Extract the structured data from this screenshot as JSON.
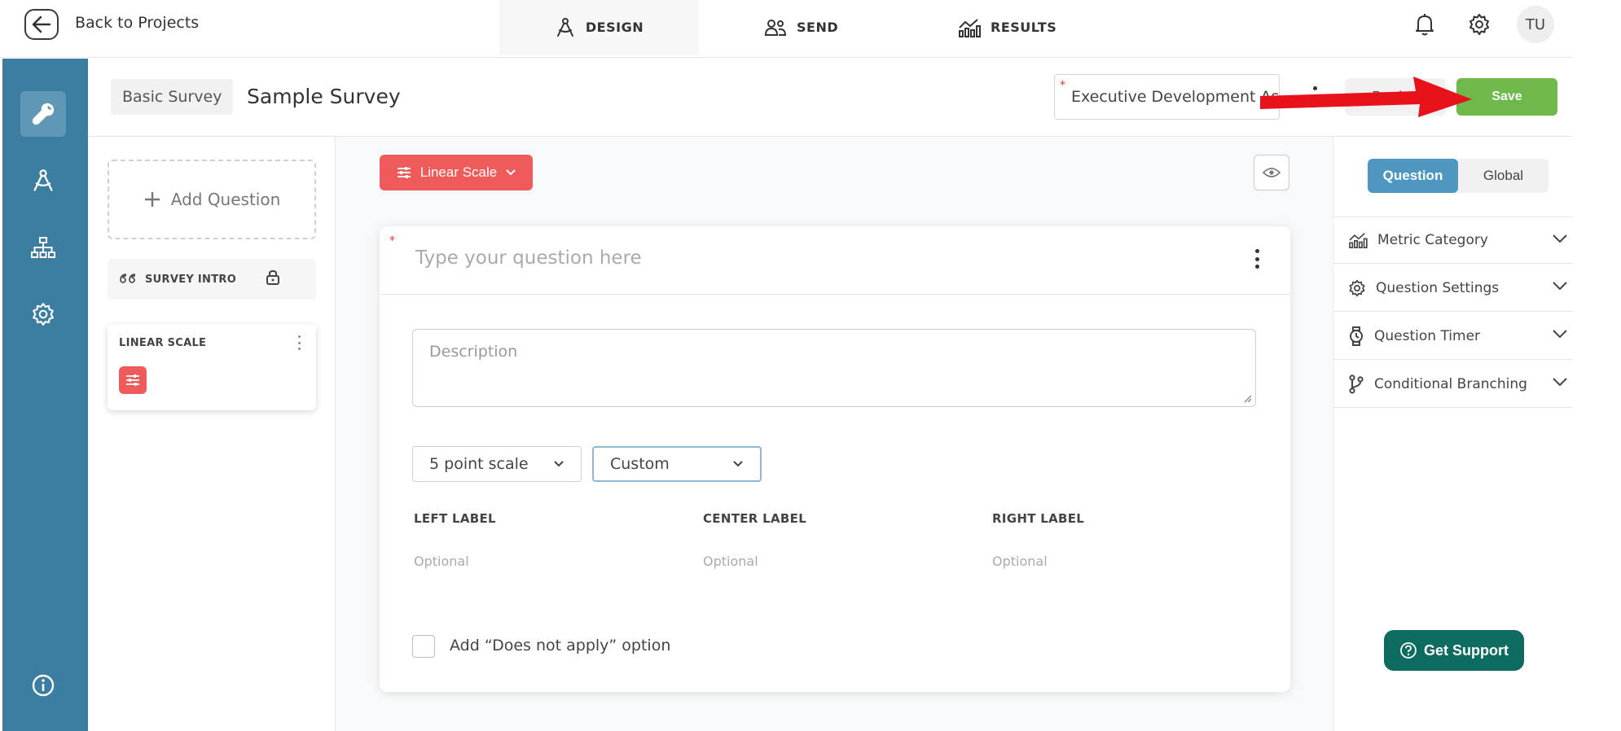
{
  "topbar": {
    "back_label": "Back to Projects",
    "tabs": [
      {
        "label": "DESIGN",
        "active": true
      },
      {
        "label": "SEND",
        "active": false
      },
      {
        "label": "RESULTS",
        "active": false
      }
    ],
    "user_initials": "TU"
  },
  "header": {
    "survey_type": "Basic Survey",
    "survey_title": "Sample Survey",
    "project_name": "Executive Development As",
    "preview_label": "Preview",
    "save_label": "Save"
  },
  "sidebar": {
    "add_question_label": "Add Question",
    "intro_label": "SURVEY INTRO",
    "question_card_title": "LINEAR SCALE"
  },
  "editor": {
    "type_label": "Linear Scale",
    "question_placeholder": "Type your question here",
    "description_placeholder": "Description",
    "scale_select": "5 point scale",
    "label_mode_select": "Custom",
    "left_label": "LEFT LABEL",
    "center_label": "CENTER LABEL",
    "right_label": "RIGHT LABEL",
    "optional_placeholder": "Optional",
    "does_not_apply_label": "Add “Does not apply” option"
  },
  "right_panel": {
    "tabs": [
      {
        "label": "Question",
        "active": true
      },
      {
        "label": "Global",
        "active": false
      }
    ],
    "sections": [
      {
        "label": "Metric Category",
        "icon": "metric-icon"
      },
      {
        "label": "Question Settings",
        "icon": "gear-icon"
      },
      {
        "label": "Question Timer",
        "icon": "timer-icon"
      },
      {
        "label": "Conditional Branching",
        "icon": "branch-icon"
      }
    ],
    "support_label": "Get Support"
  },
  "colors": {
    "rail": "#3b7ea1",
    "save": "#6fb94b",
    "accent_red": "#ef5b5b",
    "segment_active": "#4f97c1",
    "support": "#0e6b5f"
  }
}
